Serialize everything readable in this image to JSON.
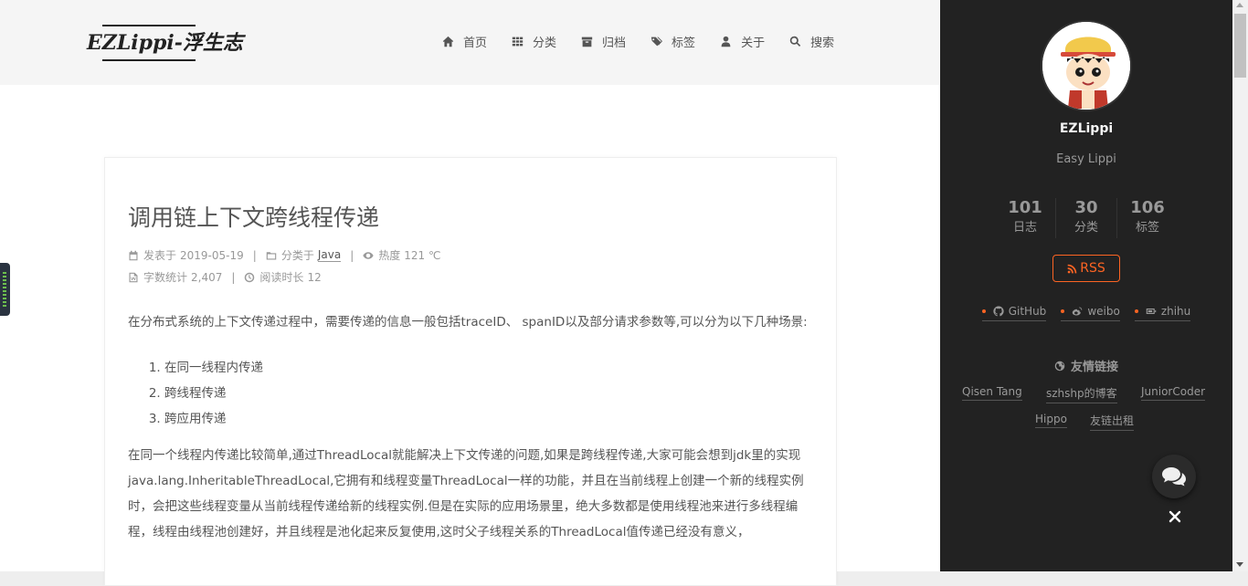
{
  "header": {
    "brand": "EZLippi-浮生志",
    "nav": [
      {
        "label": "首页",
        "icon": "home-icon"
      },
      {
        "label": "分类",
        "icon": "grid-icon"
      },
      {
        "label": "归档",
        "icon": "archive-icon"
      },
      {
        "label": "标签",
        "icon": "tags-icon"
      },
      {
        "label": "关于",
        "icon": "user-icon"
      },
      {
        "label": "搜索",
        "icon": "search-icon"
      }
    ]
  },
  "post": {
    "title": "调用链上下文跨线程传递",
    "meta": {
      "published_label": "发表于",
      "published_date": "2019-05-19",
      "category_label": "分类于",
      "category": "Java",
      "views_label": "热度",
      "views": "121 ℃",
      "wordcount_label": "字数统计",
      "wordcount": "2,407",
      "readtime_label": "阅读时长",
      "readtime": "12"
    },
    "intro": "在分布式系统的上下文传递过程中，需要传递的信息一般包括traceID、 spanID以及部分请求参数等,可以分为以下几种场景:",
    "list": [
      "在同一线程内传递",
      "跨线程传递",
      "跨应用传递"
    ],
    "para2": "在同一个线程内传递比较简单,通过ThreadLocal就能解决上下文传递的问题,如果是跨线程传递,大家可能会想到jdk里的实现java.lang.InheritableThreadLocal,它拥有和线程变量ThreadLocal一样的功能，并且在当前线程上创建一个新的线程实例时，会把这些线程变量从当前线程传递给新的线程实例.但是在实际的应用场景里，绝大多数都是使用线程池来进行多线程编程，线程由线程池创建好，并且线程是池化起来反复使用,这时父子线程关系的ThreadLocal值传递已经没有意义，"
  },
  "sidebar": {
    "name": "EZLippi",
    "description": "Easy Lippi",
    "stats": [
      {
        "num": "101",
        "label": "日志"
      },
      {
        "num": "30",
        "label": "分类"
      },
      {
        "num": "106",
        "label": "标签"
      }
    ],
    "rss": "RSS",
    "links": [
      {
        "label": "GitHub",
        "icon": "github-icon"
      },
      {
        "label": "weibo",
        "icon": "weibo-icon"
      },
      {
        "label": "zhihu",
        "icon": "zhihu-icon"
      }
    ],
    "friends_title": "友情链接",
    "friends": [
      "Qisen Tang",
      "szhshp的博客",
      "JuniorCoder",
      "Hippo",
      "友链出租"
    ]
  },
  "colors": {
    "accent": "#fc6423",
    "sidebar_bg": "#222222",
    "header_bg": "#f5f5f5"
  }
}
